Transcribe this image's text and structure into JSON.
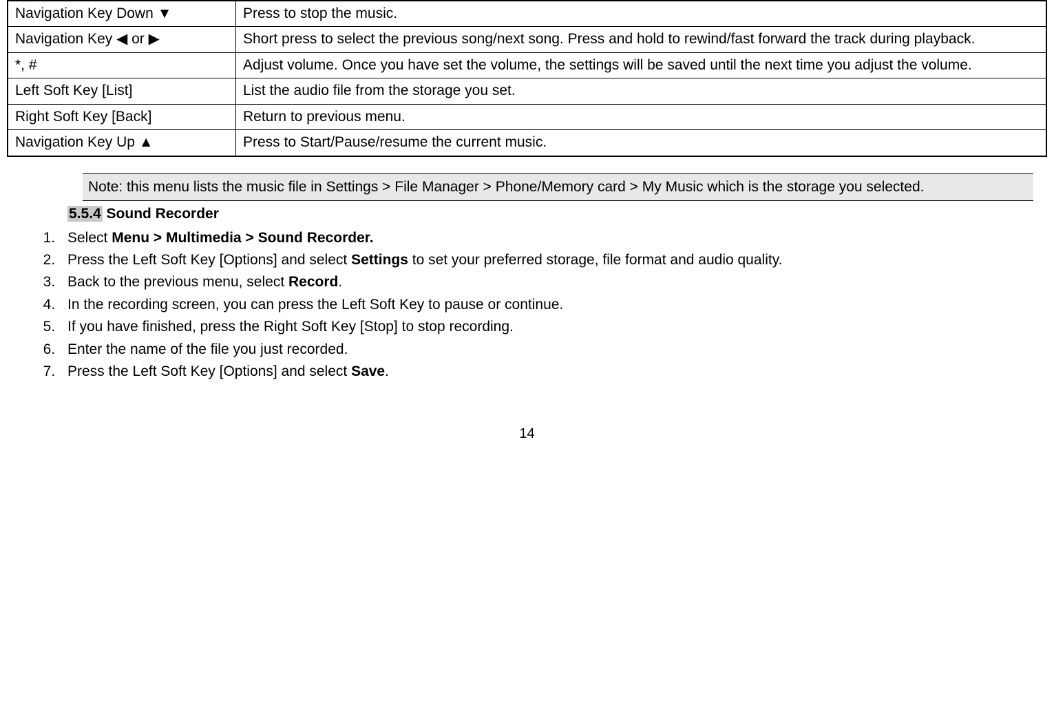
{
  "table": {
    "rows": [
      {
        "key": "Navigation Key Down ▼",
        "desc": "Press to stop the music."
      },
      {
        "key": "Navigation Key  ◀  or  ▶",
        "desc": "Short press to select the previous song/next song. Press and hold to rewind/fast forward the track during playback."
      },
      {
        "key": "*, #",
        "desc": "Adjust volume. Once you have set the volume, the settings will be saved until the next time you adjust the volume."
      },
      {
        "key": "Left Soft Key [List]",
        "desc": "List the audio file from the storage you set."
      },
      {
        "key": "Right Soft Key [Back]",
        "desc": "Return to previous menu."
      },
      {
        "key": "Navigation Key Up ▲",
        "desc": "Press to Start/Pause/resume the current music."
      }
    ]
  },
  "note": "Note: this menu lists the music file in Settings > File Manager > Phone/Memory card > My Music which is the storage you selected.",
  "section": {
    "number": "5.5.4",
    "title": " Sound Recorder"
  },
  "steps": {
    "s1a": "Select ",
    "s1b": "Menu > Multimedia > Sound Recorder.",
    "s2a": "Press the Left Soft Key [Options] and select ",
    "s2b": "Settings",
    "s2c": " to set your preferred storage, file format and audio quality.",
    "s3a": "Back to the previous menu, select ",
    "s3b": "Record",
    "s3c": ".",
    "s4": "In the recording screen, you can press the Left Soft Key to pause or continue.",
    "s5": "If you have finished, press the Right Soft Key [Stop] to stop recording.",
    "s6": "Enter the name of the file you just recorded.",
    "s7a": "Press the Left Soft Key [Options] and select ",
    "s7b": "Save",
    "s7c": "."
  },
  "page_number": "14"
}
